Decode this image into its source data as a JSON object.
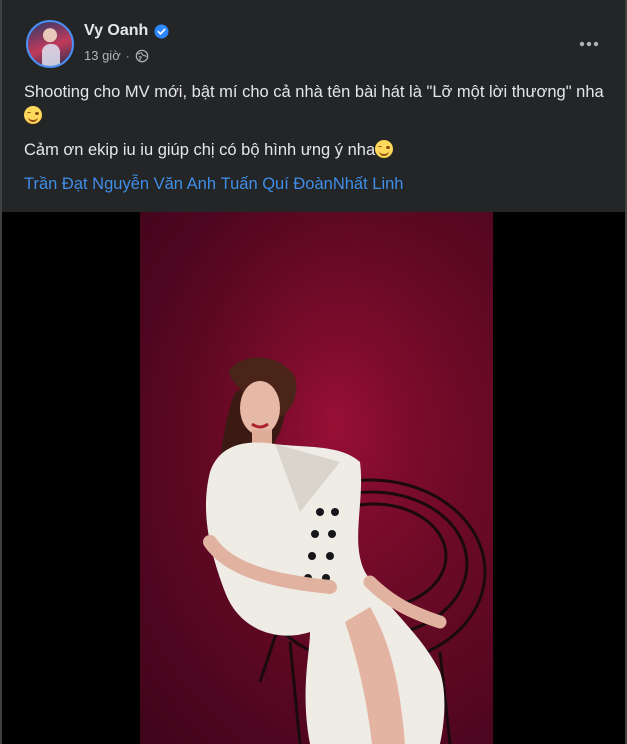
{
  "post": {
    "author": "Vy Oanh",
    "time": "13 giờ",
    "separator": "·",
    "verified_icon": "verified-badge-icon",
    "privacy_icon": "globe-icon",
    "menu_icon": "more-options-icon",
    "text_line1": "Shooting cho MV mới, bật mí cho cả nhà tên bài hát là \"Lỡ một lời thương\" nha",
    "text_line2": "Cảm ơn ekip iu iu giúp chị có bộ hình ưng ý nha",
    "emoji": "smiling-face-emoji",
    "tags": [
      "Trần Đạt",
      "Nguyễn Văn Anh",
      "Tuấn Quí Đoàn",
      "Nhất Linh"
    ]
  },
  "colors": {
    "background": "#242526",
    "text": "#e4e6eb",
    "secondary_text": "#b0b3b8",
    "link": "#3f8ee8",
    "verified": "#2d88ff",
    "photo_backdrop": "#6c0a26"
  }
}
